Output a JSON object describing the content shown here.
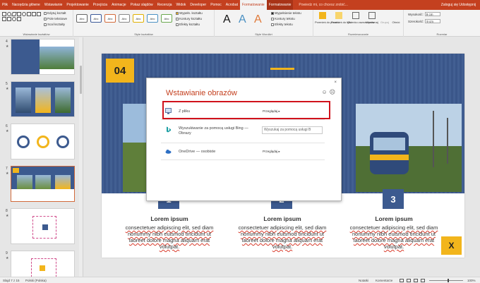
{
  "tabs": [
    "Plik",
    "Narzędzia główne",
    "Wstawianie",
    "Projektowanie",
    "Przejścia",
    "Animacje",
    "Pokaz slajdów",
    "Recenzja",
    "Widok",
    "Developer",
    "Pomoc",
    "Acrobat",
    "Formatowanie",
    "Formatowanie"
  ],
  "tell_me": "Powiedz mi, co chcesz zrobić...",
  "user": "Zaloguj się   Udostępnij",
  "ribbon": {
    "insert_shapes": {
      "edit_shape": "Edytuj kształt",
      "textbox": "Pole tekstowe",
      "merge": "Scal kształty",
      "label": "Wstawianie kształtów"
    },
    "shape_styles": {
      "sample": "Abc",
      "fill": "Wypełn. kształtu",
      "outline": "Kontury kształtu",
      "effects": "Efekty kształtu",
      "label": "Style kształtów"
    },
    "wordart": {
      "letter": "A",
      "text_fill": "Wypełnienie tekstu",
      "text_outline": "Kontury tekstu",
      "text_effects": "Efekty tekstu",
      "label": "Style WordArt"
    },
    "arrange": {
      "forward": "Przenieś do przodu",
      "backward": "Przenieś do tyłu",
      "selection": "Okienko zaznaczenia",
      "align": "Wyrównaj",
      "group": "Grupuj",
      "rotate": "Obróć",
      "label": "Rozmieszczanie"
    },
    "size": {
      "height_label": "Wysokość:",
      "height": "9 cm",
      "width_label": "Szerokość:",
      "width": "9 cm",
      "label": "Rozmiar"
    }
  },
  "thumbnails": [
    {
      "num": "4"
    },
    {
      "num": "5"
    },
    {
      "num": "6"
    },
    {
      "num": "7"
    },
    {
      "num": "8"
    },
    {
      "num": "9"
    }
  ],
  "slide": {
    "number": "04",
    "columns": [
      {
        "num": "1",
        "title": "Lorem ipsum",
        "text": "consectetuer adipiscing elit, sed diam nonummy nibh euismod tincidunt ut laoreet dolore magna aliquam erat volutpat."
      },
      {
        "num": "2",
        "title": "Lorem ipsum",
        "text": "consectetuer adipiscing elit, sed diam nonummy nibh euismod tincidunt ut laoreet dolore magna aliquam erat volutpat."
      },
      {
        "num": "3",
        "title": "Lorem ipsum",
        "text": "consectetuer adipiscing elit, sed diam nonummy nibh euismod tincidunt ut laoreet dolore magna aliquam erat volutpat."
      }
    ],
    "x_label": "X"
  },
  "dialog": {
    "title": "Wstawianie obrazów",
    "close": "×",
    "rows": [
      {
        "label": "Z pliku",
        "action": "Przeglądaj ▸"
      },
      {
        "label": "Wyszukiwanie za pomocą usługi Bing — Obrazy",
        "placeholder": "Wyszukaj za pomocą usługi B"
      },
      {
        "label": "OneDrive — osobiste",
        "action": "Przeglądaj ▸"
      }
    ]
  },
  "status": {
    "slide": "Slajd 7 z 15",
    "lang": "Polski (Polska)",
    "notes": "Notatki",
    "comments": "Komentarze",
    "zoom": "100%"
  }
}
